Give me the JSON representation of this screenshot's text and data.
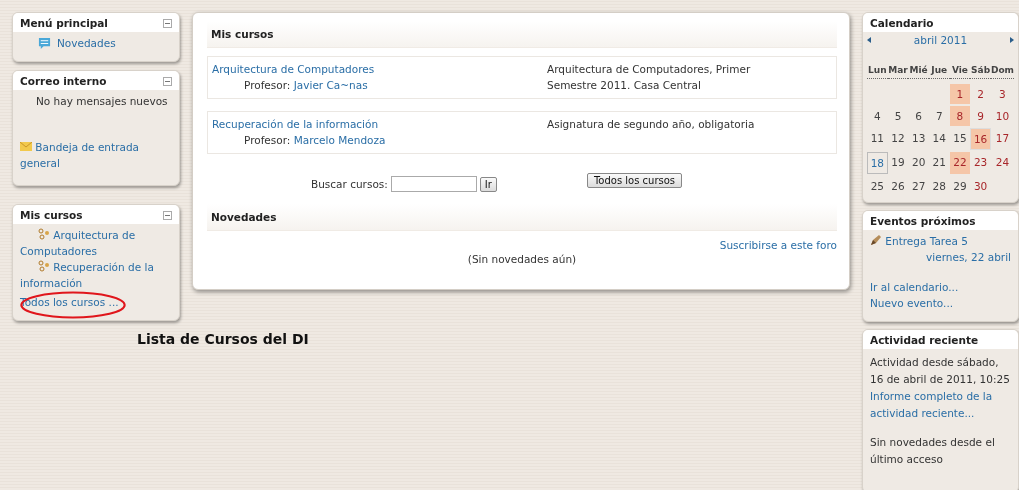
{
  "main_menu": {
    "title": "Menú principal",
    "items": [
      "Novedades"
    ]
  },
  "mail": {
    "title": "Correo interno",
    "message": "No hay mensajes nuevos",
    "link": "Bandeja de entrada general"
  },
  "my_courses_block": {
    "title": "Mis cursos",
    "courses": [
      "Arquitectura de Computadores",
      "Recuperación de la información"
    ],
    "all_link": {
      "label": "Todos los cursos ...",
      "circled": true
    }
  },
  "annotation": {
    "caption": "Lista de Cursos del DI"
  },
  "courses_panel": {
    "title": "Mis cursos",
    "courses": [
      {
        "name": "Arquitectura de Computadores",
        "teacher_label": "Profesor:",
        "teacher": "Javier Ca~nas",
        "summary": "Arquitectura de Computadores, Primer Semestre 2011. Casa Central"
      },
      {
        "name": "Recuperación de la información",
        "teacher_label": "Profesor:",
        "teacher": "Marcelo Mendoza",
        "summary": "Asignatura de segundo año, obligatoria"
      }
    ],
    "search": {
      "label": "Buscar cursos:",
      "button": "Ir"
    },
    "all_button": "Todos los cursos"
  },
  "news": {
    "title": "Novedades",
    "subscribe": "Suscribirse a este foro",
    "empty": "(Sin novedades aún)"
  },
  "calendar": {
    "title": "Calendario",
    "month": "abril 2011",
    "weekdays": [
      "Lun",
      "Mar",
      "Mié",
      "Jue",
      "Vie",
      "Sáb",
      "Dom"
    ],
    "weeks": [
      [
        {
          "day": "1",
          "kind": "event"
        },
        {
          "day": "2",
          "kind": "weekend"
        },
        {
          "day": "3",
          "kind": "weekend"
        }
      ],
      [
        {
          "day": "4",
          "kind": "plain"
        },
        {
          "day": "5",
          "kind": "plain"
        },
        {
          "day": "6",
          "kind": "plain"
        },
        {
          "day": "7",
          "kind": "plain"
        },
        {
          "day": "8",
          "kind": "event"
        },
        {
          "day": "9",
          "kind": "weekend"
        },
        {
          "day": "10",
          "kind": "weekend"
        }
      ],
      [
        {
          "day": "11",
          "kind": "plain"
        },
        {
          "day": "12",
          "kind": "plain"
        },
        {
          "day": "13",
          "kind": "plain"
        },
        {
          "day": "14",
          "kind": "plain"
        },
        {
          "day": "15",
          "kind": "plain"
        },
        {
          "day": "16",
          "kind": "today"
        },
        {
          "day": "17",
          "kind": "weekend"
        }
      ],
      [
        {
          "day": "18",
          "kind": "marked"
        },
        {
          "day": "19",
          "kind": "plain"
        },
        {
          "day": "20",
          "kind": "plain"
        },
        {
          "day": "21",
          "kind": "plain"
        },
        {
          "day": "22",
          "kind": "event"
        },
        {
          "day": "23",
          "kind": "weekend"
        },
        {
          "day": "24",
          "kind": "weekend"
        }
      ],
      [
        {
          "day": "25",
          "kind": "plain"
        },
        {
          "day": "26",
          "kind": "plain"
        },
        {
          "day": "27",
          "kind": "plain"
        },
        {
          "day": "28",
          "kind": "plain"
        },
        {
          "day": "29",
          "kind": "plain"
        },
        {
          "day": "30",
          "kind": "weekend"
        }
      ]
    ]
  },
  "events": {
    "title": "Eventos próximos",
    "items": [
      {
        "name": "Entrega Tarea 5",
        "date": "viernes, 22 abril"
      }
    ],
    "links": [
      "Ir al calendario...",
      "Nuevo evento..."
    ]
  },
  "activity": {
    "title": "Actividad reciente",
    "since": "Actividad desde sábado, 16 de abril de 2011, 10:25",
    "link": "Informe completo de la actividad reciente...",
    "empty": "Sin novedades desde el último acceso"
  }
}
